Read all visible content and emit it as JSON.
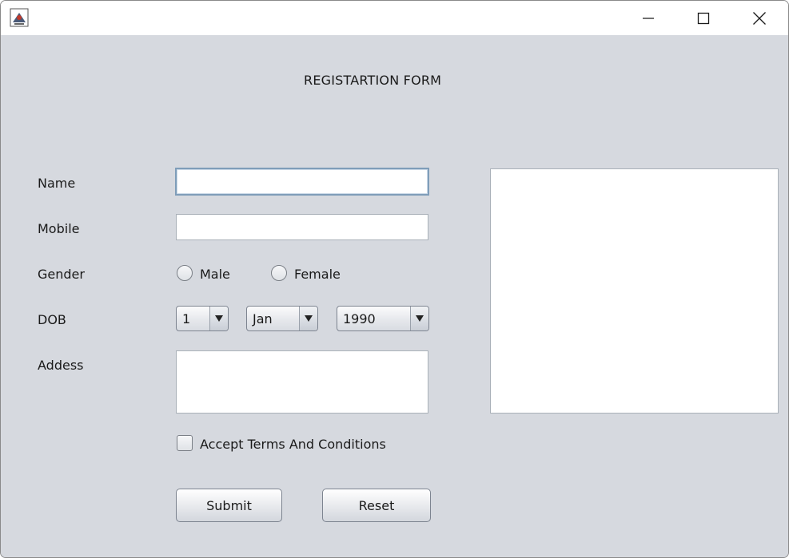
{
  "window": {
    "title": "",
    "controls": {
      "minimize": "minimize-icon",
      "maximize": "maximize-icon",
      "close": "close-icon"
    }
  },
  "form": {
    "heading": "REGISTARTION FORM",
    "name": {
      "label": "Name",
      "value": ""
    },
    "mobile": {
      "label": "Mobile",
      "value": ""
    },
    "gender": {
      "label": "Gender",
      "options": [
        "Male",
        "Female"
      ],
      "selected": null
    },
    "dob": {
      "label": "DOB",
      "day": "1",
      "month": "Jan",
      "year": "1990"
    },
    "address": {
      "label": "Addess",
      "value": ""
    },
    "terms": {
      "label": "Accept Terms And Conditions",
      "checked": false
    },
    "buttons": {
      "submit": "Submit",
      "reset": "Reset"
    }
  },
  "output": {
    "value": ""
  },
  "colors": {
    "panel_bg": "#d6d9df",
    "field_bg": "#ffffff",
    "focus_border": "#7f9db9"
  }
}
